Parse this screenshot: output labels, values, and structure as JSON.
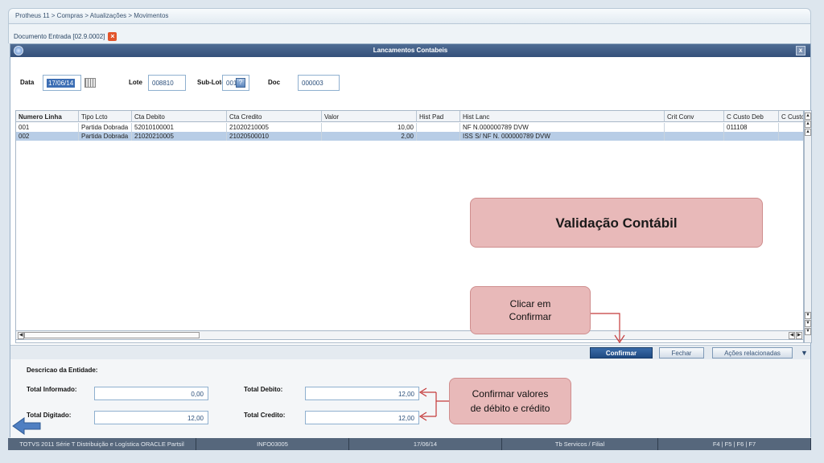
{
  "breadcrumb": "Protheus 11 > Compras  > Atualizações > Movimentos",
  "document_tab": {
    "label": "Documento Entrada [02.9.0002]"
  },
  "dialog": {
    "title": "Lancamentos Contabeis",
    "close_label": "x"
  },
  "form": {
    "data_label": "Data",
    "data_value": "17/06/14",
    "lote_label": "Lote",
    "lote_value": "008810",
    "sublote_label": "Sub-Lote",
    "sublote_value": "001",
    "help_label": "?",
    "doc_label": "Doc",
    "doc_value": "000003"
  },
  "grid": {
    "columns": [
      "Numero Linha",
      "Tipo Lcto",
      "Cta Debito",
      "Cta Credito",
      "Valor",
      "Hist Pad",
      "Hist Lanc",
      "Crit Conv",
      "C Custo Deb",
      "C Custo"
    ],
    "rows": [
      [
        "001",
        "Partida Dobrada",
        "52010100001",
        "21020210005",
        "10,00",
        "",
        "NF N.000000789 DVW",
        "",
        "011108",
        ""
      ],
      [
        "002",
        "Partida Dobrada",
        "21020210005",
        "21020500010",
        "2,00",
        "",
        "ISS S/ NF N. 000000789 DVW",
        "",
        "",
        ""
      ]
    ],
    "selected_row": 1
  },
  "buttons": {
    "confirm": "Confirmar",
    "close": "Fechar",
    "related": "Ações relacionadas"
  },
  "totals": {
    "entity_label": "Descricao da Entidade:",
    "informado_label": "Total Informado:",
    "informado_value": "0,00",
    "digitado_label": "Total Digitado:",
    "digitado_value": "12,00",
    "debito_label": "Total Debito:",
    "debito_value": "12,00",
    "credito_label": "Total Credito:",
    "credito_value": "12,00"
  },
  "statusbar": [
    "TOTVS 2011 Série T Distribuição e Logística ORACLE Partsil",
    "INFO03005",
    "17/06/14",
    "Tb Servicos / Filial",
    "F4 | F5 | F6 | F7"
  ],
  "annotations": {
    "main": "Validação Contábil",
    "click_confirm": [
      "Clicar  em",
      "Confirmar"
    ],
    "confirm_values": [
      "Confirmar valores",
      "de débito e crédito"
    ],
    "color": "#e8b9b9"
  },
  "colors": {
    "titlebar": "#34507a",
    "primary_button": "#1f4a82",
    "selected_row": "#b8cde6",
    "statusbar": "#56677c"
  }
}
